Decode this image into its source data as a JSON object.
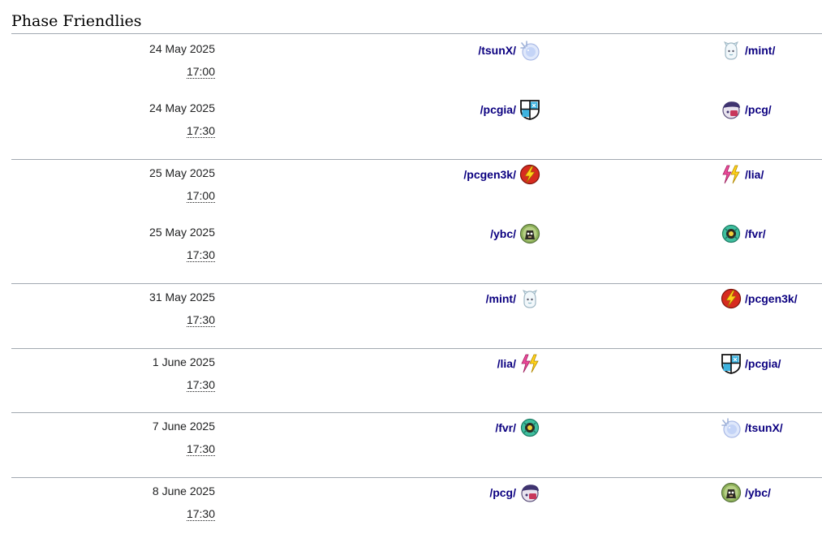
{
  "title": "Phase Friendlies",
  "matches": [
    {
      "date": "24 May 2025",
      "time": "17:00",
      "home": "/tsunX/",
      "home_icon": "tsunx-icon",
      "away": "/mint/",
      "away_icon": "mint-icon"
    },
    {
      "date": "24 May 2025",
      "time": "17:30",
      "home": "/pcgia/",
      "home_icon": "pcgia-icon",
      "away": "/pcg/",
      "away_icon": "pcg-icon"
    },
    {
      "date": "25 May 2025",
      "time": "17:00",
      "home": "/pcgen3k/",
      "home_icon": "pcgen3k-icon",
      "away": "/lia/",
      "away_icon": "lia-icon"
    },
    {
      "date": "25 May 2025",
      "time": "17:30",
      "home": "/ybc/",
      "home_icon": "ybc-icon",
      "away": "/fvr/",
      "away_icon": "fvr-icon"
    },
    {
      "date": "31 May 2025",
      "time": "17:30",
      "home": "/mint/",
      "home_icon": "mint-icon",
      "away": "/pcgen3k/",
      "away_icon": "pcgen3k-icon"
    },
    {
      "date": "1 June 2025",
      "time": "17:30",
      "home": "/lia/",
      "home_icon": "lia-icon",
      "away": "/pcgia/",
      "away_icon": "pcgia-icon"
    },
    {
      "date": "7 June 2025",
      "time": "17:30",
      "home": "/fvr/",
      "home_icon": "fvr-icon",
      "away": "/tsunX/",
      "away_icon": "tsunx-icon"
    },
    {
      "date": "8 June 2025",
      "time": "17:30",
      "home": "/pcg/",
      "home_icon": "pcg-icon",
      "away": "/ybc/",
      "away_icon": "ybc-icon"
    }
  ],
  "colors": {
    "link": "#0b0080",
    "divider": "#a2a9b1"
  }
}
